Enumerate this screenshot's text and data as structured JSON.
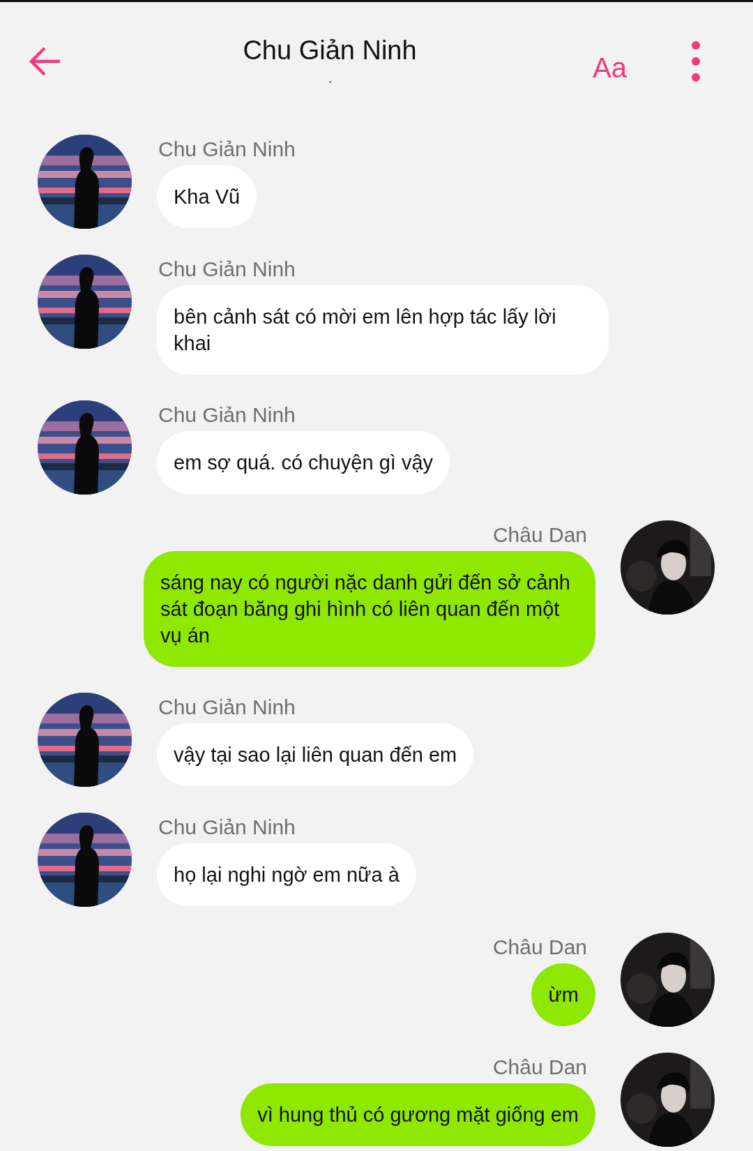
{
  "header": {
    "title": "Chu Giản Ninh",
    "font_button": "Aa"
  },
  "messages": [
    {
      "kind": "received",
      "sender": "Chu Giản Ninh",
      "text": "Kha Vũ"
    },
    {
      "kind": "received",
      "sender": "Chu Giản Ninh",
      "text": "bên cảnh sát có mời em lên hợp tác lấy lời khai"
    },
    {
      "kind": "received",
      "sender": "Chu Giản Ninh",
      "text": "em sợ quá. có chuyện gì vậy"
    },
    {
      "kind": "sent",
      "sender": "Châu Dan",
      "text": "sáng nay có người nặc danh gửi đến sở cảnh sát đoạn băng ghi hình có liên quan đến một vụ án"
    },
    {
      "kind": "received",
      "sender": "Chu Giản Ninh",
      "text": "vậy tại sao lại liên quan đến em"
    },
    {
      "kind": "received",
      "sender": "Chu Giản Ninh",
      "text": "họ lại nghi ngờ em nữa à"
    },
    {
      "kind": "sent",
      "sender": "Châu Dan",
      "text": "ừm"
    },
    {
      "kind": "sent",
      "sender": "Châu Dan",
      "text": "vì hung thủ có gương mặt giống em"
    }
  ]
}
